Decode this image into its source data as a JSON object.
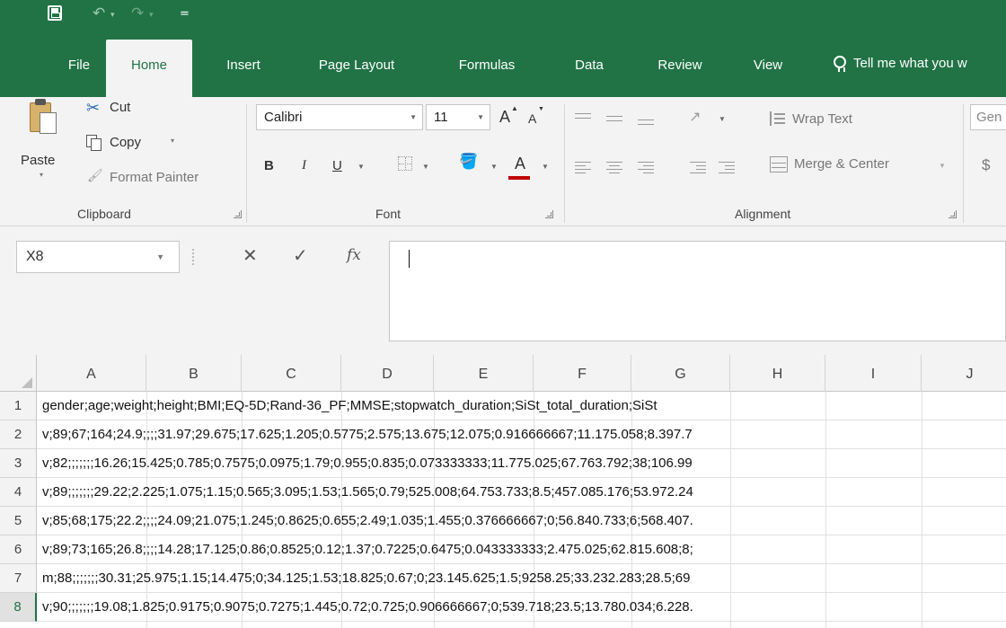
{
  "quick_access": {
    "save_icon": "save-icon",
    "undo_glyph": "↶",
    "redo_glyph": "↷",
    "dropdown_glyph": "▾",
    "customize_glyph": "="
  },
  "tabs": [
    {
      "label": "File"
    },
    {
      "label": "Home"
    },
    {
      "label": "Insert"
    },
    {
      "label": "Page Layout"
    },
    {
      "label": "Formulas"
    },
    {
      "label": "Data"
    },
    {
      "label": "Review"
    },
    {
      "label": "View"
    }
  ],
  "tell_me": "Tell me what you w",
  "clipboard": {
    "paste": "Paste",
    "cut": "Cut",
    "copy": "Copy",
    "format_painter": "Format Painter",
    "label": "Clipboard"
  },
  "font": {
    "name": "Calibri",
    "size": "11",
    "label": "Font",
    "bold": "B",
    "italic": "I",
    "underline": "U",
    "grow": "A",
    "shrink": "A",
    "color_letter": "A"
  },
  "alignment": {
    "wrap_text": "Wrap Text",
    "merge_center": "Merge & Center",
    "label": "Alignment"
  },
  "number": {
    "format": "Gen",
    "currency": "$"
  },
  "formula_bar": {
    "name_box": "X8",
    "cancel_glyph": "✕",
    "enter_glyph": "✓",
    "fx": "fx",
    "content": ""
  },
  "columns": [
    "A",
    "B",
    "C",
    "D",
    "E",
    "F",
    "G",
    "H",
    "I",
    "J"
  ],
  "rows": [
    {
      "num": "1",
      "text": "gender;age;weight;height;BMI;EQ-5D;Rand-36_PF;MMSE;stopwatch_duration;SiSt_total_duration;SiSt"
    },
    {
      "num": "2",
      "text": "v;89;67;164;24.9;;;;31.97;29.675;17.625;1.205;0.5775;2.575;13.675;12.075;0.916666667;11.175.058;8.397.7"
    },
    {
      "num": "3",
      "text": "v;82;;;;;;;16.26;15.425;0.785;0.7575;0.0975;1.79;0.955;0.835;0.073333333;11.775.025;67.763.792;38;106.99"
    },
    {
      "num": "4",
      "text": "v;89;;;;;;;29.22;2.225;1.075;1.15;0.565;3.095;1.53;1.565;0.79;525.008;64.753.733;8.5;457.085.176;53.972.24"
    },
    {
      "num": "5",
      "text": "v;85;68;175;22.2;;;;24.09;21.075;1.245;0.8625;0.655;2.49;1.035;1.455;0.376666667;0;56.840.733;6;568.407."
    },
    {
      "num": "6",
      "text": "v;89;73;165;26.8;;;;14.28;17.125;0.86;0.8525;0.12;1.37;0.7225;0.6475;0.043333333;2.475.025;62.815.608;8;"
    },
    {
      "num": "7",
      "text": "m;88;;;;;;;30.31;25.975;1.15;14.475;0;34.125;1.53;18.825;0.67;0;23.145.625;1.5;9258.25;33.232.283;28.5;69"
    },
    {
      "num": "8",
      "text": "v;90;;;;;;;19.08;1.825;0.9175;0.9075;0.7275;1.445;0.72;0.725;0.906666667;0;539.718;23.5;13.780.034;6.228."
    }
  ],
  "selected_row": "8",
  "colors": {
    "excel_green": "#217346",
    "ribbon_bg": "#f3f3f3",
    "font_color_red": "#c00000"
  }
}
